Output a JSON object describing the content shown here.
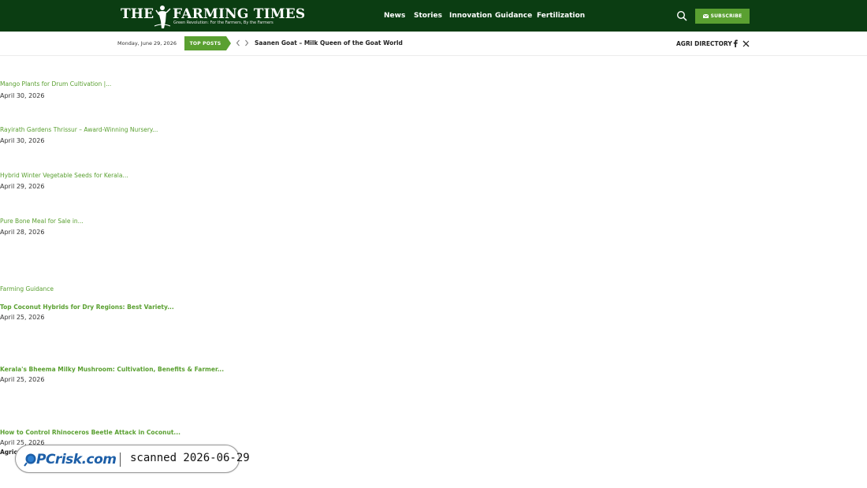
{
  "header": {
    "logo_title_left": "THE",
    "logo_title_right": "FARMING TIMES",
    "logo_tagline": "Green Revolution: For the Farmers, By the Farmers",
    "nav": [
      "News",
      "Stories",
      "Innovation",
      "Guidance",
      "Fertilization"
    ],
    "subscribe_label": "SUBSCRIBE",
    "colors": {
      "header_bg": "#0b3d12",
      "accent": "#5aa031"
    }
  },
  "ticker": {
    "date": "Monday, June 29, 2026",
    "label": "TOP POSTS",
    "headline": "Saanen Goat – Milk Queen of the Goat World",
    "agri_directory": "AGRI DIRECTORY"
  },
  "recent_posts": [
    {
      "title": "Mango Plants for Drum Cultivation |...",
      "date": "April 30, 2026"
    },
    {
      "title": "Rayirath Gardens Thrissur – Award-Winning Nursery...",
      "date": "April 30, 2026"
    },
    {
      "title": "Hybrid Winter Vegetable Seeds for Kerala...",
      "date": "April 29, 2026"
    },
    {
      "title": "Pure Bone Meal for Sale in...",
      "date": "April 28, 2026"
    }
  ],
  "guidance": {
    "section_title": "Farming Guidance",
    "posts": [
      {
        "title": "Top Coconut Hybrids for Dry Regions: Best Variety...",
        "date": "April 25, 2026"
      },
      {
        "title": "Kerala's Bheema Milky Mushroom: Cultivation, Benefits & Farmer...",
        "date": "April 25, 2026"
      },
      {
        "title": "How to Control Rhinoceros Beetle Attack in Coconut...",
        "date": "April 25, 2026"
      }
    ],
    "trailing_category": "Agric"
  },
  "watermark": {
    "brand": "PCrisk.com",
    "scan_text": "scanned 2026-06-29"
  }
}
